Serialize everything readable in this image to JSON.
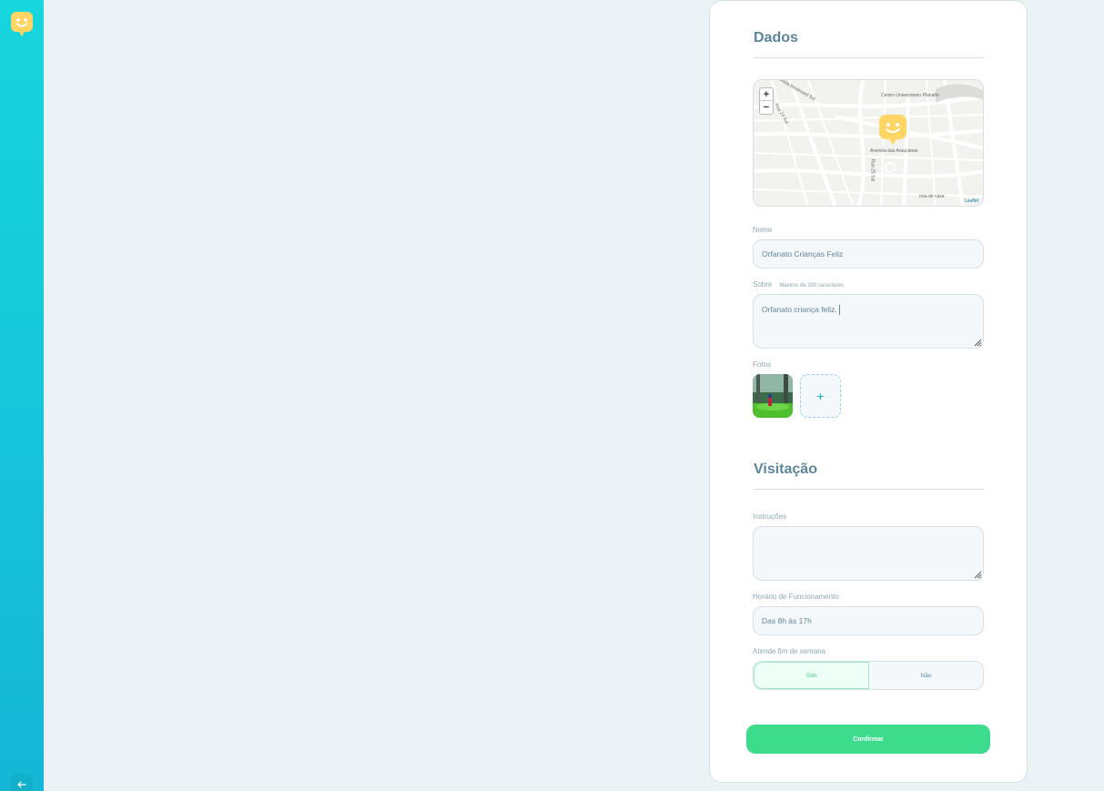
{
  "sidebar": {
    "logo_icon": "smiley-pin-icon",
    "back_icon": "arrow-left-icon"
  },
  "form": {
    "dados_title": "Dados",
    "map": {
      "zoom_in": "+",
      "zoom_out": "−",
      "labels": [
        "Centro Universitario Planalto",
        "Avenida Boulevard Sul",
        "Rua 24 Sul",
        "Avenida das Araucárias",
        "Rua 25 Sul",
        "rota de casa",
        "Leaflet"
      ]
    },
    "name": {
      "label": "Nome",
      "value": "Orfanato Crianças Feliz"
    },
    "about": {
      "label": "Sobre",
      "hint": "Máximo de 300 caracteres",
      "value": "Orfanato criança feliz."
    },
    "photos": {
      "label": "Fotos",
      "add_label": "+"
    },
    "visit_title": "Visitação",
    "instructions": {
      "label": "Instruções",
      "value": ""
    },
    "opening_hours": {
      "label": "Horário de Funcionamento",
      "value": "Das 8h às 17h"
    },
    "weekends": {
      "label": "Atende fim de semana",
      "yes": "Sim",
      "no": "Não",
      "selected": "Sim"
    },
    "confirm_label": "Confirmar"
  },
  "colors": {
    "sidebar_top": "#17d6dd",
    "sidebar_bottom": "#15b6d6",
    "title": "#5c8599",
    "confirm": "#3cdc8c",
    "marker": "#ffd666"
  }
}
